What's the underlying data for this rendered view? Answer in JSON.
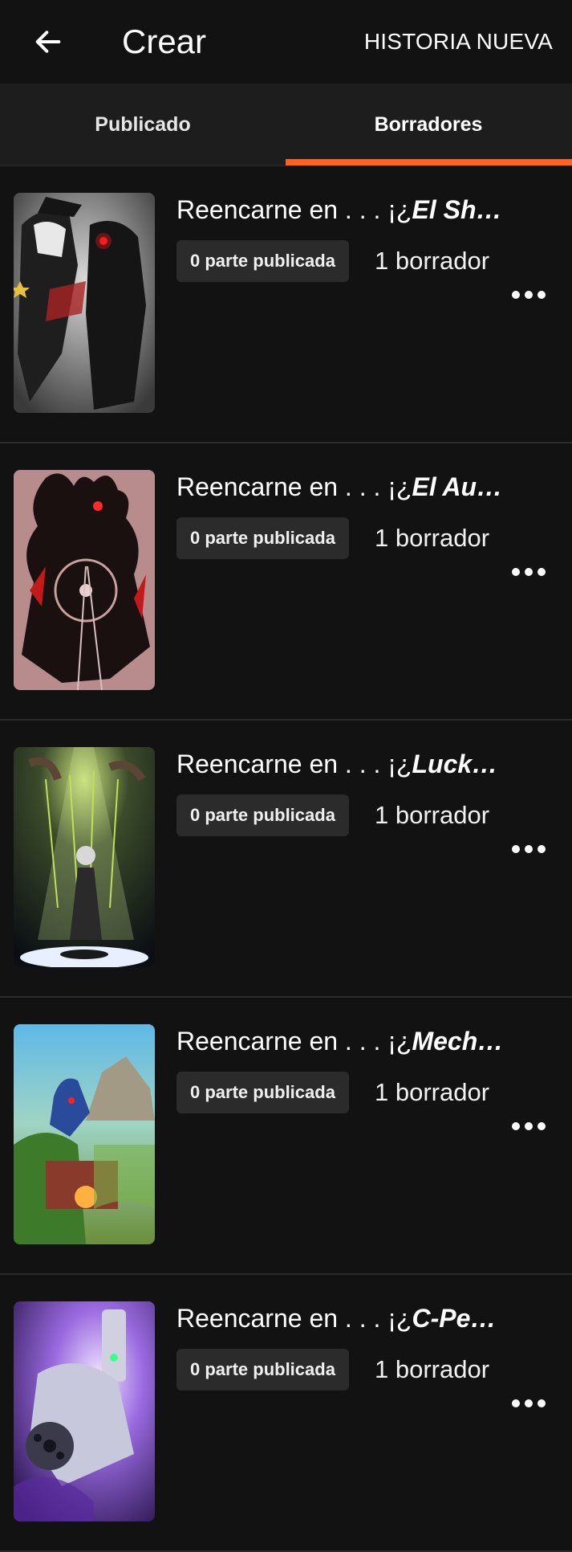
{
  "header": {
    "back_icon": "arrow-left-icon",
    "title": "Crear",
    "new_story_label": "HISTORIA NUEVA"
  },
  "tabs": [
    {
      "label": "Publicado",
      "selected": false
    },
    {
      "label": "Borradores",
      "selected": true
    }
  ],
  "colors": {
    "accent": "#ff6122",
    "background": "#121212",
    "tab_bar": "#1d1d1d",
    "badge": "#2b2b2b"
  },
  "stories": [
    {
      "title_prefix": "Reencarne en . . . ¡¿",
      "title_italic": "El Sh…",
      "published_badge": "0 parte publicada",
      "drafts": "1 borrador",
      "more_icon": "more-dots-icon"
    },
    {
      "title_prefix": "Reencarne en . . . ¡¿",
      "title_italic": "El Au…",
      "published_badge": "0 parte publicada",
      "drafts": "1 borrador",
      "more_icon": "more-dots-icon"
    },
    {
      "title_prefix": "Reencarne en . . . ¡¿",
      "title_italic": "Luck…",
      "published_badge": "0 parte publicada",
      "drafts": "1 borrador",
      "more_icon": "more-dots-icon"
    },
    {
      "title_prefix": "Reencarne en . . . ¡¿",
      "title_italic": "Mech…",
      "published_badge": "0 parte publicada",
      "drafts": "1 borrador",
      "more_icon": "more-dots-icon"
    },
    {
      "title_prefix": "Reencarne en . . . ¡¿",
      "title_italic": "C-Pe…",
      "published_badge": "0 parte publicada",
      "drafts": "1 borrador",
      "more_icon": "more-dots-icon"
    }
  ]
}
